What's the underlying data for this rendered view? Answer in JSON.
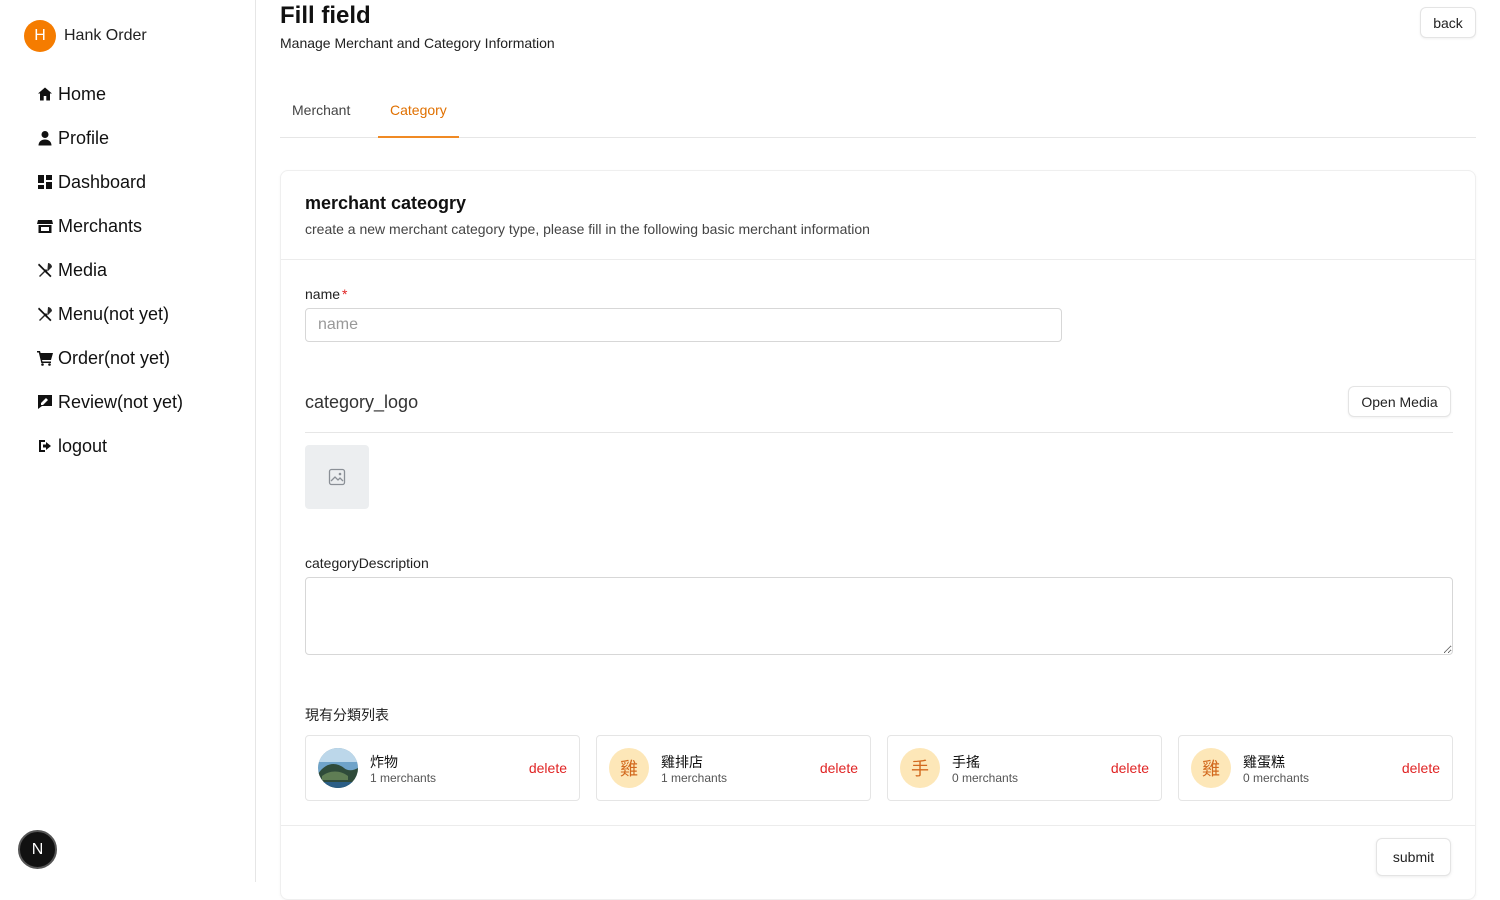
{
  "app": {
    "avatar_letter": "H",
    "name": "Hank Order"
  },
  "sidebar": {
    "items": [
      {
        "label": "Home",
        "icon": "home-icon"
      },
      {
        "label": "Profile",
        "icon": "user-icon"
      },
      {
        "label": "Dashboard",
        "icon": "dashboard-icon"
      },
      {
        "label": "Merchants",
        "icon": "store-icon"
      },
      {
        "label": "Media",
        "icon": "utensils-icon"
      },
      {
        "label": "Menu(not yet)",
        "icon": "utensils-icon"
      },
      {
        "label": "Order(not yet)",
        "icon": "cart-icon"
      },
      {
        "label": "Review(not yet)",
        "icon": "review-icon"
      },
      {
        "label": "logout",
        "icon": "logout-icon"
      }
    ],
    "badge": "N"
  },
  "header": {
    "title": "Fill field",
    "subtitle": "Manage Merchant and Category Information",
    "back_label": "back"
  },
  "tabs": [
    {
      "label": "Merchant",
      "active": false
    },
    {
      "label": "Category",
      "active": true
    }
  ],
  "form": {
    "title": "merchant cateogry",
    "description": "create a new merchant category type, please fill in the following basic merchant information",
    "name_label": "name",
    "required_mark": "*",
    "name_placeholder": "name",
    "name_value": "",
    "logo_label": "category_logo",
    "open_media_label": "Open Media",
    "description_label": "categoryDescription",
    "description_value": "",
    "list_title": "現有分類列表",
    "submit_label": "submit"
  },
  "categories": [
    {
      "avatar": "",
      "name": "炸物",
      "count": "1 merchants",
      "delete_label": "delete",
      "has_image": true
    },
    {
      "avatar": "雞",
      "name": "雞排店",
      "count": "1 merchants",
      "delete_label": "delete",
      "has_image": false
    },
    {
      "avatar": "手",
      "name": "手搖",
      "count": "0 merchants",
      "delete_label": "delete",
      "has_image": false
    },
    {
      "avatar": "雞",
      "name": "雞蛋糕",
      "count": "0 merchants",
      "delete_label": "delete",
      "has_image": false
    }
  ],
  "colors": {
    "accent": "#f08a24",
    "danger": "#e02424",
    "avatar_bg": "#f57c00",
    "cat_avatar_bg": "#fde7b8"
  }
}
